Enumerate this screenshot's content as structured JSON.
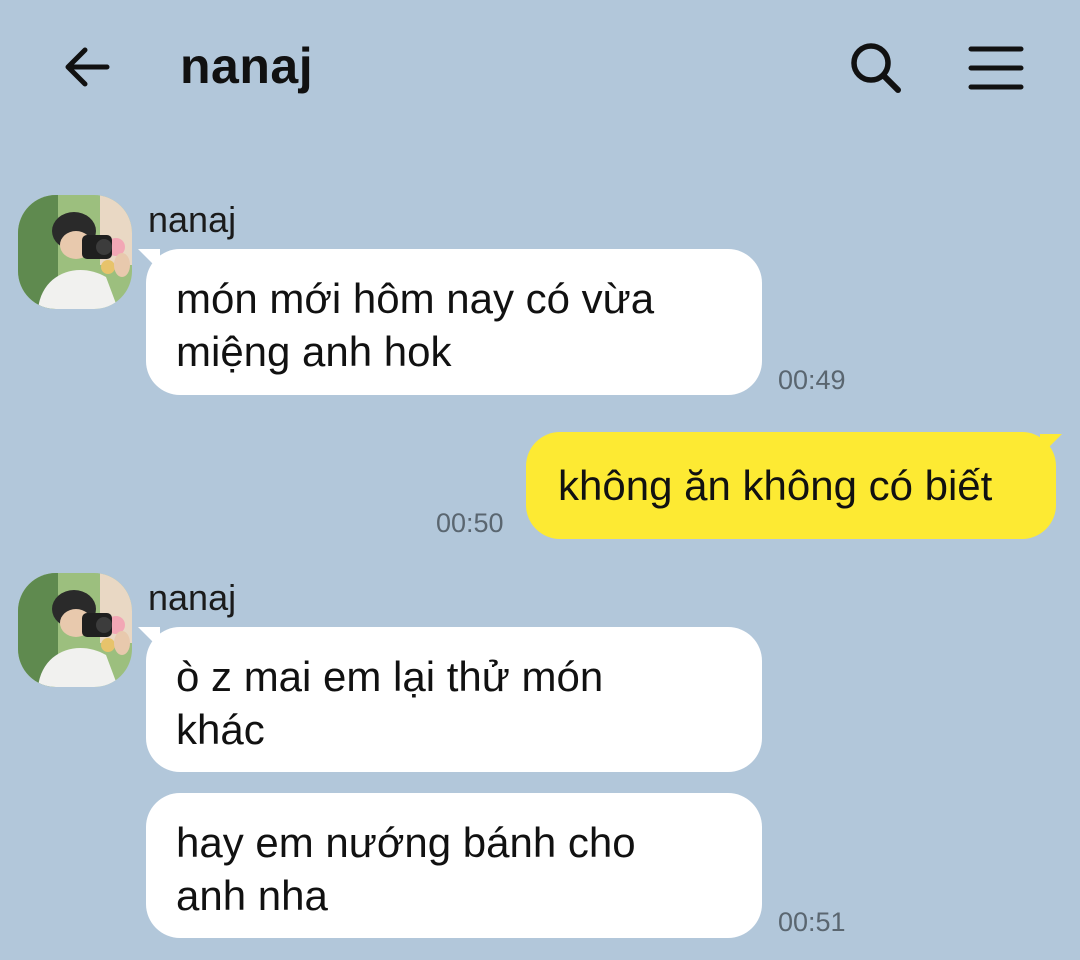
{
  "header": {
    "title": "nanaj",
    "back_icon": "arrow-left-icon",
    "search_icon": "search-icon",
    "menu_icon": "hamburger-menu-icon"
  },
  "messages": [
    {
      "direction": "incoming",
      "sender": "nanaj",
      "lines": [
        "món mới hôm nay có vừa",
        "miệng anh hok"
      ],
      "time": "00:49"
    },
    {
      "direction": "outgoing",
      "text": "không ăn không có biết",
      "time": "00:50"
    },
    {
      "direction": "incoming",
      "sender": "nanaj",
      "lines": [
        "ò z mai em lại thử món",
        "khác"
      ]
    },
    {
      "direction": "incoming",
      "lines": [
        "hay em nướng bánh cho",
        "anh nha"
      ],
      "time": "00:51"
    }
  ],
  "colors": {
    "background": "#b2c7da",
    "incoming_bubble": "#ffffff",
    "outgoing_bubble": "#fdea33",
    "timestamp": "#5a6670"
  }
}
